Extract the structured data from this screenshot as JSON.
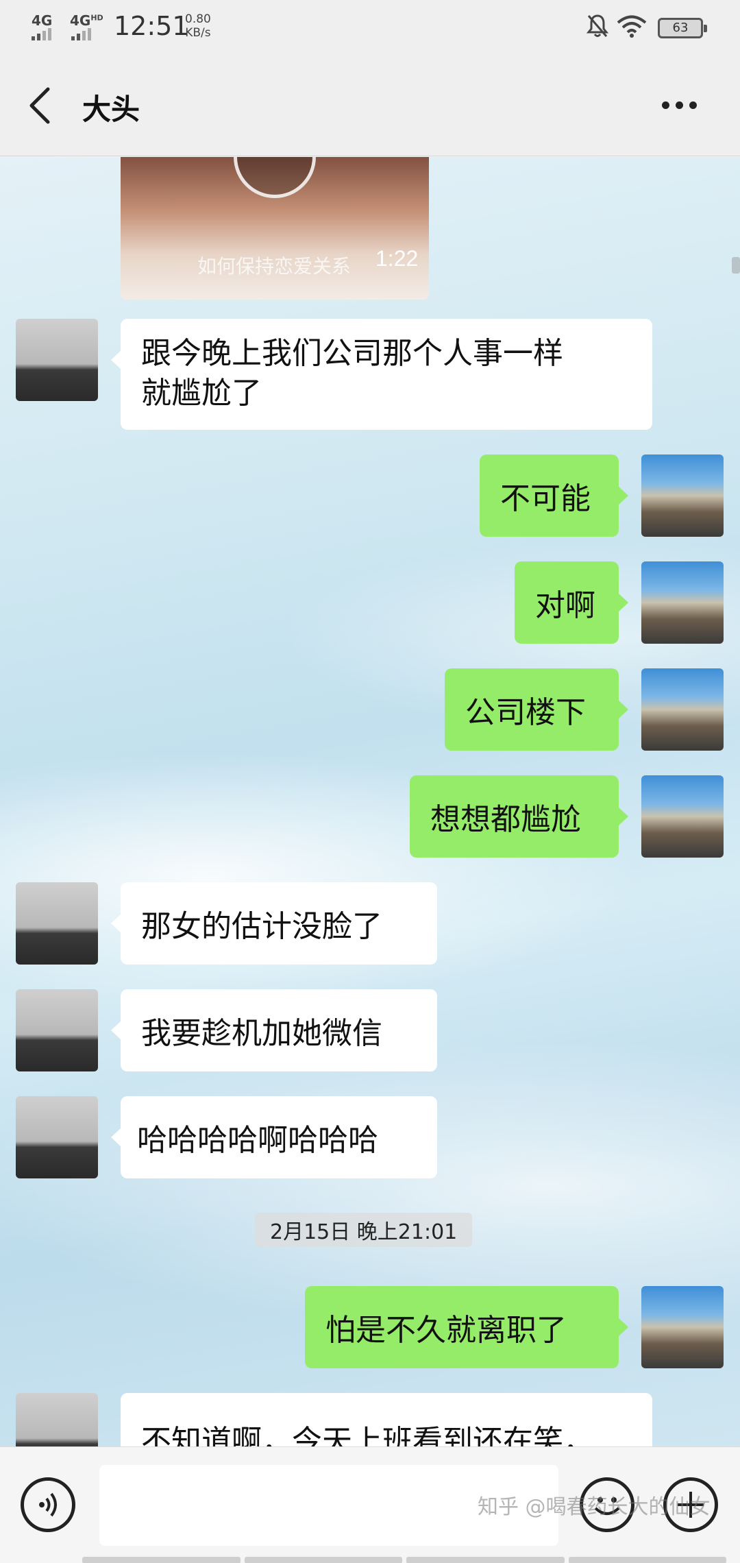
{
  "status_bar": {
    "sim1": "4G",
    "sim2": "4G",
    "sim2_sup": "HD",
    "time": "12:51",
    "net_speed_value": "0.80",
    "net_speed_unit": "KB/s",
    "battery": "63"
  },
  "header": {
    "title": "大头"
  },
  "video": {
    "caption": "如何保持恋爱关系",
    "duration": "1:22"
  },
  "messages": [
    {
      "side": "left",
      "lines": [
        "跟今晚上我们公司那个人事一样",
        "就尴尬了"
      ]
    },
    {
      "side": "right",
      "text": "不可能"
    },
    {
      "side": "right",
      "text": "对啊"
    },
    {
      "side": "right",
      "text": "公司楼下"
    },
    {
      "side": "right",
      "text": "想想都尴尬"
    },
    {
      "side": "left",
      "text": "那女的估计没脸了"
    },
    {
      "side": "left",
      "text": "我要趁机加她微信"
    },
    {
      "side": "left",
      "text": "哈哈哈哈啊哈哈哈"
    },
    {
      "side": "right",
      "text": "怕是不久就离职了"
    },
    {
      "side": "left",
      "text": "不知道啊，今天上班看到还在笑，"
    }
  ],
  "timestamp": "2月15日 晚上21:01",
  "watermark": "知乎 @喝春药长大的仙女",
  "colors": {
    "bubble_self": "#95ec69",
    "bubble_other": "#ffffff"
  }
}
